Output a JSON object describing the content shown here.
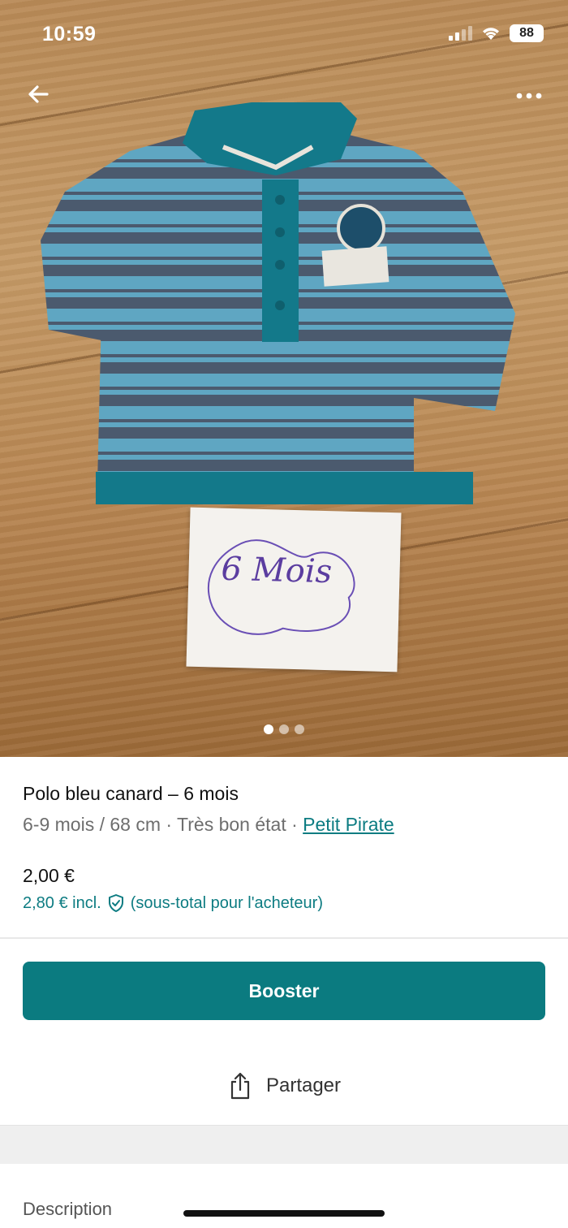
{
  "status_bar": {
    "time": "10:59",
    "battery": "88"
  },
  "nav": {
    "back_icon": "arrow-left-icon",
    "more_icon": "ellipsis-icon"
  },
  "photo": {
    "note_text": "6 Mois",
    "dots_total": 3,
    "active_dot_index": 0
  },
  "item": {
    "title": "Polo bleu canard – 6 mois",
    "size": "6-9 mois / 68 cm",
    "condition": "Très bon état",
    "separator": "·",
    "brand": "Petit Pirate",
    "price": "2,00 €",
    "price_incl": "2,80 € incl.",
    "price_incl_note": "(sous-total pour l'acheteur)"
  },
  "actions": {
    "booster_label": "Booster",
    "share_label": "Partager"
  },
  "section": {
    "description_label": "Description"
  },
  "colors": {
    "accent": "#0b7b80",
    "link": "#0d7c82"
  }
}
